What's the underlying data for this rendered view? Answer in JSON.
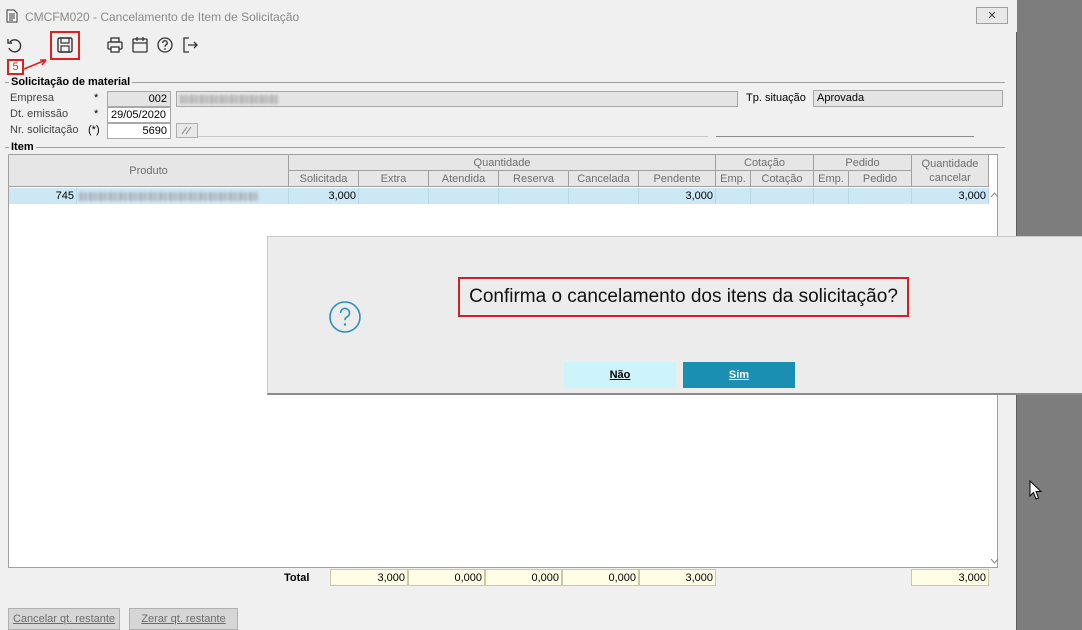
{
  "window": {
    "title": "CMCFM020 - Cancelamento de Item de Solicitação",
    "close_label": "✕"
  },
  "annotation": {
    "step": "5"
  },
  "section_solicitacao": {
    "title": "Solicitação de material",
    "empresa_label": "Empresa",
    "empresa_req": "*",
    "empresa_value": "002",
    "emissao_label": "Dt. emissão",
    "emissao_req": "*",
    "emissao_value": "29/05/2020",
    "nr_label": "Nr. solicitação",
    "nr_req": "(*)",
    "nr_value": "5690",
    "tp_situacao_label": "Tp. situação",
    "tp_situacao_value": "Aprovada"
  },
  "section_item": {
    "title": "Item"
  },
  "grid": {
    "group_headers": {
      "produto": "Produto",
      "quantidade": "Quantidade",
      "cotacao": "Cotação",
      "pedido": "Pedido",
      "qtd_cancelar": "Quantidade cancelar"
    },
    "sub_headers": {
      "solicitada": "Solicitada",
      "extra": "Extra",
      "atendida": "Atendida",
      "reserva": "Reserva",
      "cancelada": "Cancelada",
      "pendente": "Pendente",
      "cot_emp": "Emp.",
      "cot_cotacao": "Cotação",
      "ped_emp": "Emp.",
      "ped_pedido": "Pedido"
    },
    "row": {
      "codigo": "745",
      "solicitada": "3,000",
      "pendente": "3,000",
      "qtd_cancelar": "3,000"
    }
  },
  "totals": {
    "label": "Total",
    "solicitada": "3,000",
    "extra": "0,000",
    "atendida": "0,000",
    "reserva": "0,000",
    "pendente": "3,000",
    "qtd_cancelar": "3,000"
  },
  "bottom_buttons": {
    "cancelar": "Cancelar qt. restante",
    "zerar": "Zerar qt. restante"
  },
  "dialog": {
    "message": "Confirma o cancelamento dos itens da solicitação?",
    "no_label": "Não",
    "yes_label": "Sim",
    "icon": "question-icon"
  },
  "colors": {
    "annotation_red": "#e0201d",
    "yes_button": "#1b8fb2",
    "no_button": "#cdf3fb",
    "selected_row": "#cce8f7"
  }
}
